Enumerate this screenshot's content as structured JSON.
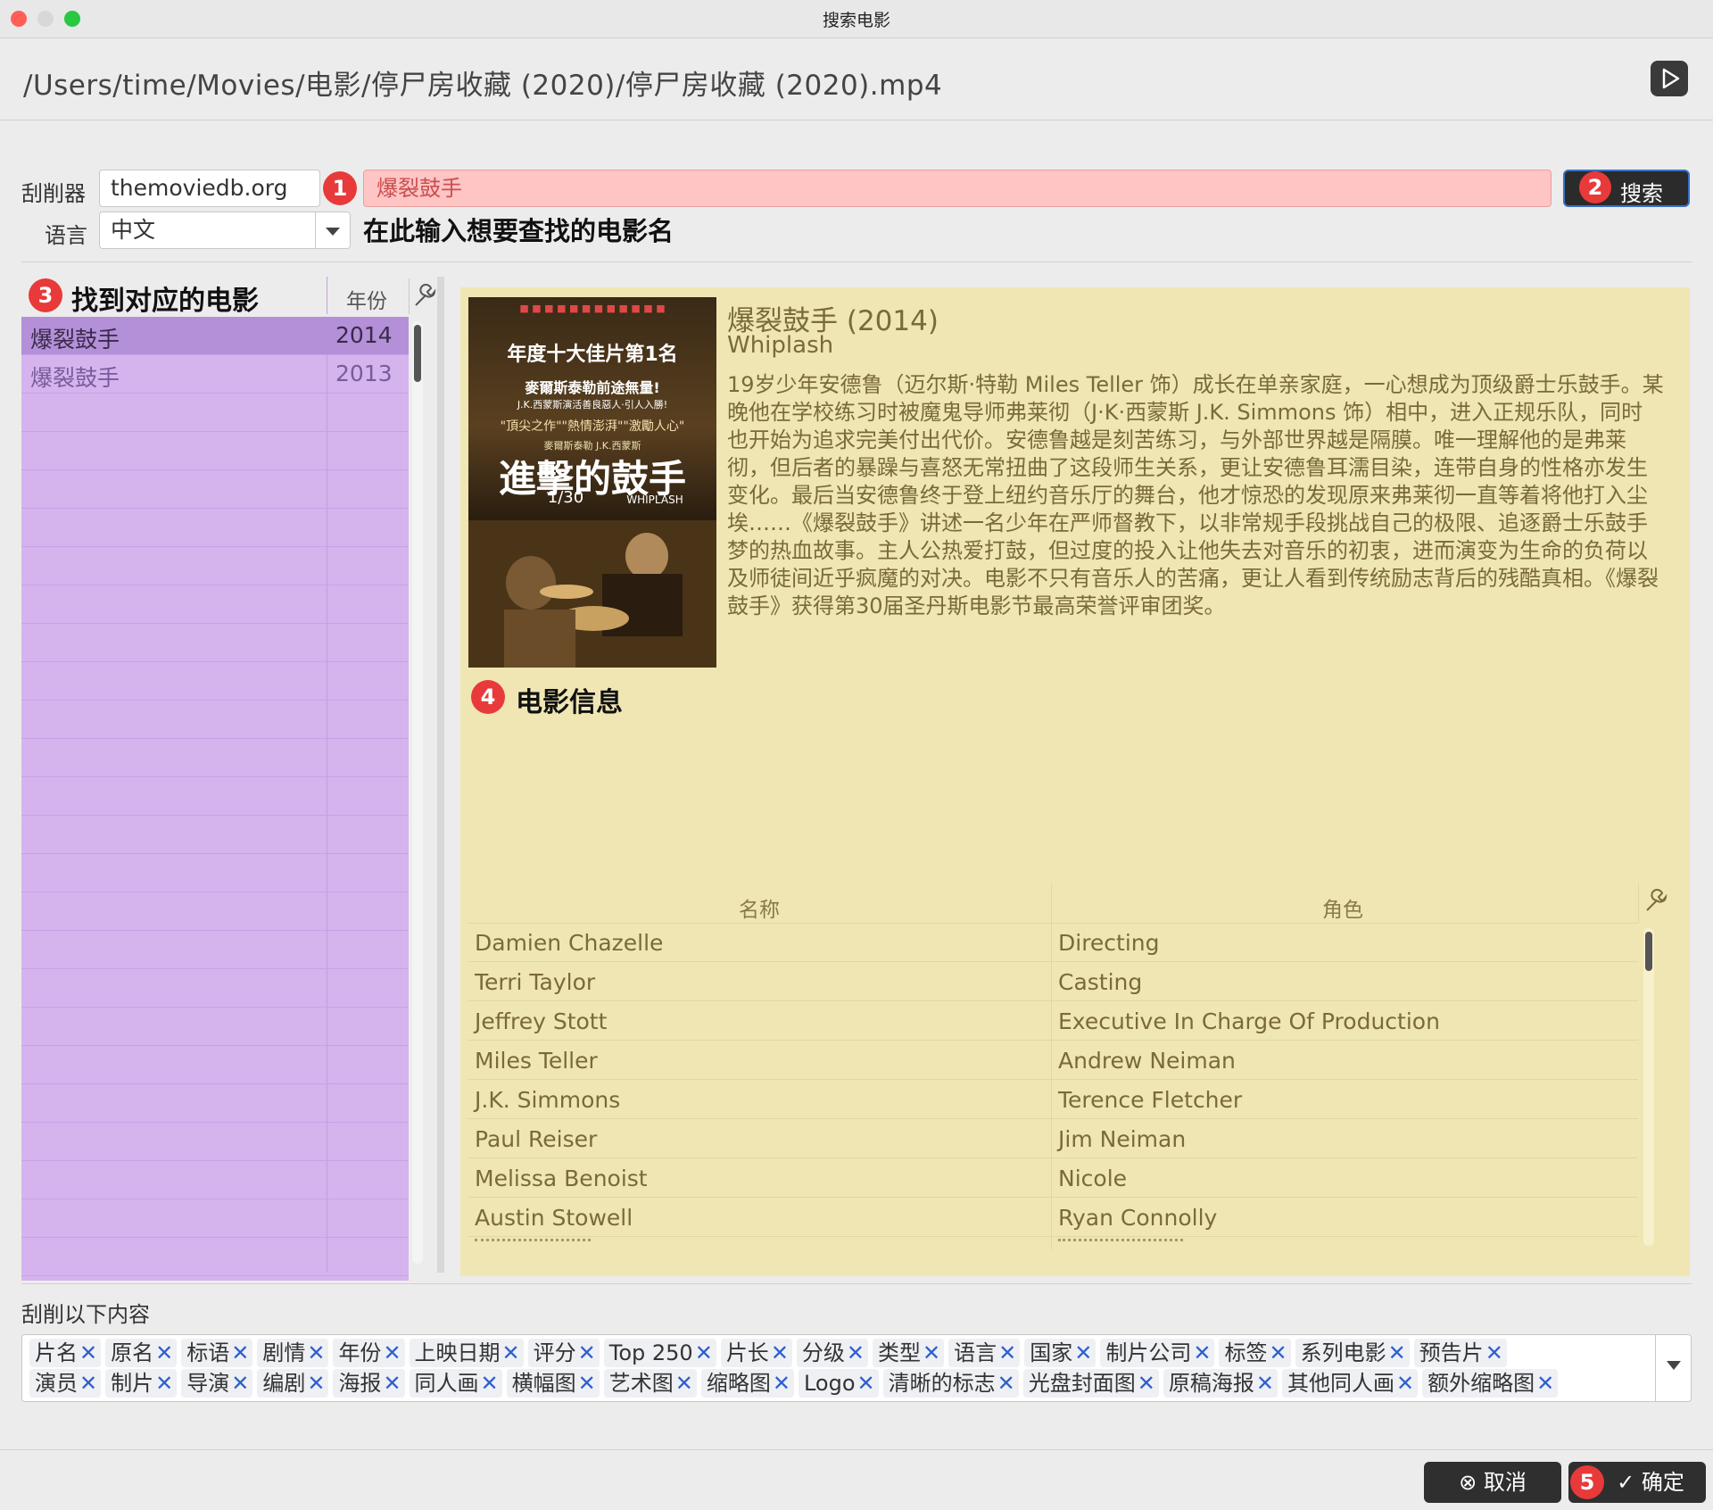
{
  "window": {
    "title": "搜索电影"
  },
  "path": "/Users/time/Movies/电影/停尸房收藏 (2020)/停尸房收藏 (2020).mp4",
  "form": {
    "scraper_label": "刮削器",
    "scraper_value": "themoviedb.org",
    "language_label": "语言",
    "language_value": "中文",
    "query_value": "爆裂鼓手",
    "search_button": "搜索",
    "hint": "在此输入想要查找的电影名"
  },
  "badges": [
    "1",
    "2",
    "3",
    "4",
    "5"
  ],
  "results": {
    "title": "找到对应的电影",
    "year_header": "年份",
    "rows": [
      {
        "name": "爆裂鼓手",
        "year": "2014"
      },
      {
        "name": "爆裂鼓手",
        "year": "2013"
      }
    ]
  },
  "movie": {
    "title": "爆裂鼓手 (2014)",
    "original_title": "Whiplash",
    "plot": "19岁少年安德鲁（迈尔斯·特勒 Miles Teller 饰）成长在单亲家庭，一心想成为顶级爵士乐鼓手。某晚他在学校练习时被魔鬼导师弗莱彻（J·K·西蒙斯 J.K. Simmons 饰）相中，进入正规乐队，同时也开始为追求完美付出代价。安德鲁越是刻苦练习，与外部世界越是隔膜。唯一理解他的是弗莱彻，但后者的暴躁与喜怒无常扭曲了这段师生关系，更让安德鲁耳濡目染，连带自身的性格亦发生变化。最后当安德鲁终于登上纽约音乐厅的舞台，他才惊恐的发现原来弗莱彻一直等着将他打入尘埃……《爆裂鼓手》讲述一名少年在严师督教下，以非常规手段挑战自己的极限、追逐爵士乐鼓手梦的热血故事。主人公热爱打鼓，但过度的投入让他失去对音乐的初衷，进而演变为生命的负荷以及师徒间近乎疯魔的对决。电影不只有音乐人的苦痛，更让人看到传统励志背后的残酷真相。《爆裂鼓手》获得第30届圣丹斯电影节最高荣誉评审团奖。",
    "section_label": "电影信息",
    "poster": {
      "line1": "年度十大佳片第1名",
      "line2": "麥爾斯泰勒前途無量!",
      "line3": "J.K.西蒙斯演活善良惡人·引人入勝!",
      "line4": "\"頂尖之作\"\"熱情澎湃\"\"激勵人心\"",
      "line5": "麥爾斯泰勒          J.K.西蒙斯",
      "title": "進擊的鼓手",
      "date": "1/30",
      "en": "WHIPLASH"
    }
  },
  "cast": {
    "header_name": "名称",
    "header_role": "角色",
    "rows": [
      {
        "name": "Damien Chazelle",
        "role": "Directing"
      },
      {
        "name": "Terri Taylor",
        "role": "Casting"
      },
      {
        "name": "Jeffrey Stott",
        "role": "Executive In Charge Of Production"
      },
      {
        "name": "Miles Teller",
        "role": "Andrew Neiman"
      },
      {
        "name": "J.K. Simmons",
        "role": "Terence Fletcher"
      },
      {
        "name": "Paul Reiser",
        "role": "Jim Neiman"
      },
      {
        "name": "Melissa Benoist",
        "role": "Nicole"
      },
      {
        "name": "Austin Stowell",
        "role": "Ryan Connolly"
      }
    ]
  },
  "scrape": {
    "label": "刮削以下内容",
    "row1": [
      "片名",
      "原名",
      "标语",
      "剧情",
      "年份",
      "上映日期",
      "评分",
      "Top 250",
      "片长",
      "分级",
      "类型",
      "语言",
      "国家",
      "制片公司",
      "标签",
      "系列电影",
      "预告片"
    ],
    "row2": [
      "演员",
      "制片",
      "导演",
      "编剧",
      "海报",
      "同人画",
      "横幅图",
      "艺术图",
      "缩略图",
      "Logo",
      "清晰的标志",
      "光盘封面图",
      "原稿海报",
      "其他同人画",
      "额外缩略图"
    ]
  },
  "buttons": {
    "cancel": "取消",
    "ok": "确定"
  },
  "colors": {
    "query_bg": "#ffc4c4",
    "list_bg": "#d5b4ee",
    "info_bg": "#efe6b3",
    "badge": "#e83a3a"
  }
}
